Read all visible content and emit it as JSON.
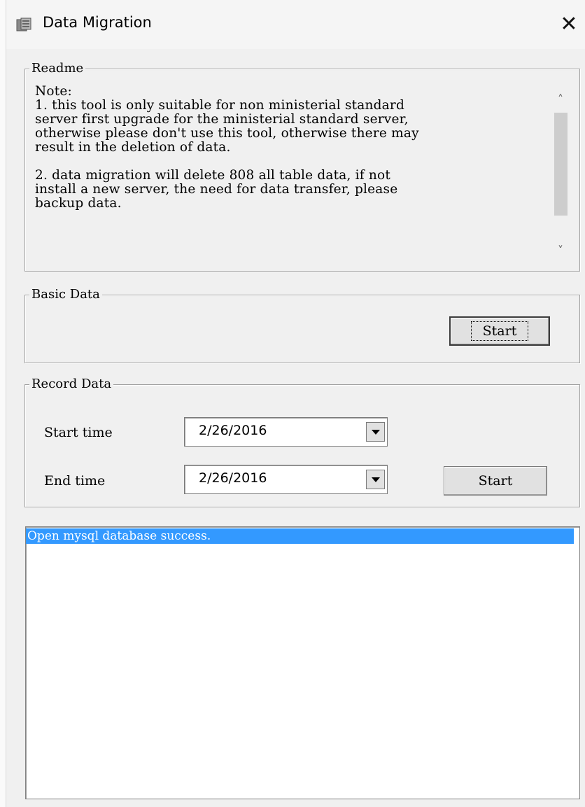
{
  "window": {
    "title": "Data Migration",
    "close_glyph": "✕",
    "app_icon": "database-tool-icon"
  },
  "readme": {
    "legend": "Readme",
    "text": "Note:\n1. this tool is only suitable for non ministerial standard\nserver first upgrade for the ministerial standard server,\notherwise please don't use this tool, otherwise there may\nresult in the deletion of data.\n\n2. data migration will delete 808 all table data, if not\ninstall a new server, the need for data transfer, please\nbackup data.",
    "scroll_up": "˄",
    "scroll_down": "˅"
  },
  "basic_data": {
    "legend": "Basic Data",
    "start_label": "Start"
  },
  "record_data": {
    "legend": "Record Data",
    "start_time_label": "Start time",
    "start_time_value": "2/26/2016",
    "end_time_label": "End time",
    "end_time_value": "2/26/2016",
    "start_label": "Start"
  },
  "log": {
    "lines": [
      "Open mysql database success."
    ],
    "selected_color": "#3399ff"
  }
}
